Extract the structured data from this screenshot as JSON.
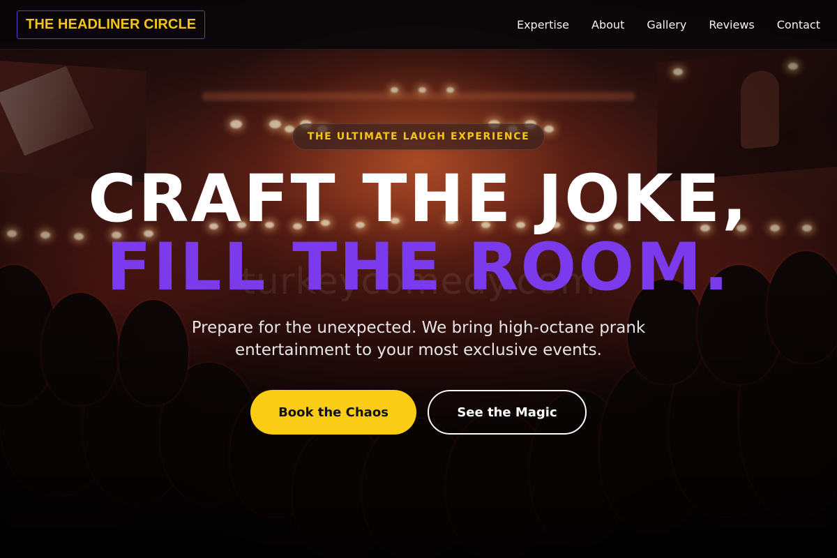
{
  "navbar": {
    "logo": "THE HEADLINER CIRCLE",
    "links": [
      "Expertise",
      "About",
      "Gallery",
      "Reviews",
      "Contact"
    ]
  },
  "hero": {
    "badge": "THE ULTIMATE LAUGH EXPERIENCE",
    "headline_line1": "CRAFT THE JOKE,",
    "headline_line2": "FILL THE ROOM.",
    "watermark": "turkeycomedy.com",
    "subtitle": "Prepare for the unexpected. We bring high-octane prank entertainment to your most exclusive events.",
    "primary_button": "Book the Chaos",
    "secondary_button": "See the Magic"
  },
  "colors": {
    "accent_yellow": "#facc15",
    "accent_purple": "#7c3aed",
    "logo_border": "#5b3bd6"
  }
}
